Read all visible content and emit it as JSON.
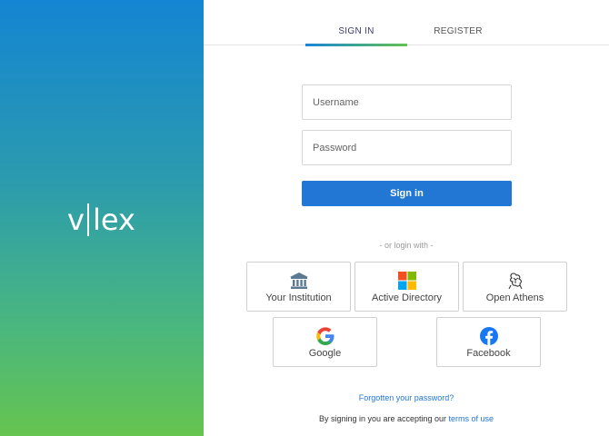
{
  "brand": {
    "logo_left": "v",
    "logo_right": "lex",
    "icon": "vlex-logo"
  },
  "tabs": [
    {
      "label": "SIGN IN",
      "active": true
    },
    {
      "label": "REGISTER",
      "active": false
    }
  ],
  "form": {
    "username_placeholder": "Username",
    "password_placeholder": "Password",
    "signin_label": "Sign in"
  },
  "or_login_with": "- or login with -",
  "providers": {
    "institution": {
      "label": "Your Institution",
      "icon": "institution-building-icon"
    },
    "active_directory": {
      "label": "Active Directory",
      "icon": "microsoft-logo-icon"
    },
    "open_athens": {
      "label": "Open Athens",
      "icon": "open-athens-logo-icon"
    },
    "google": {
      "label": "Google",
      "icon": "google-logo-icon"
    },
    "facebook": {
      "label": "Facebook",
      "icon": "facebook-logo-icon"
    }
  },
  "forgot_password": "Forgotten your password?",
  "terms": {
    "prefix": "By signing in you are accepting our ",
    "link": "terms of use"
  },
  "colors": {
    "primary": "#2277d5",
    "gradient_top": "#1485d2",
    "gradient_bottom": "#66c44f"
  }
}
